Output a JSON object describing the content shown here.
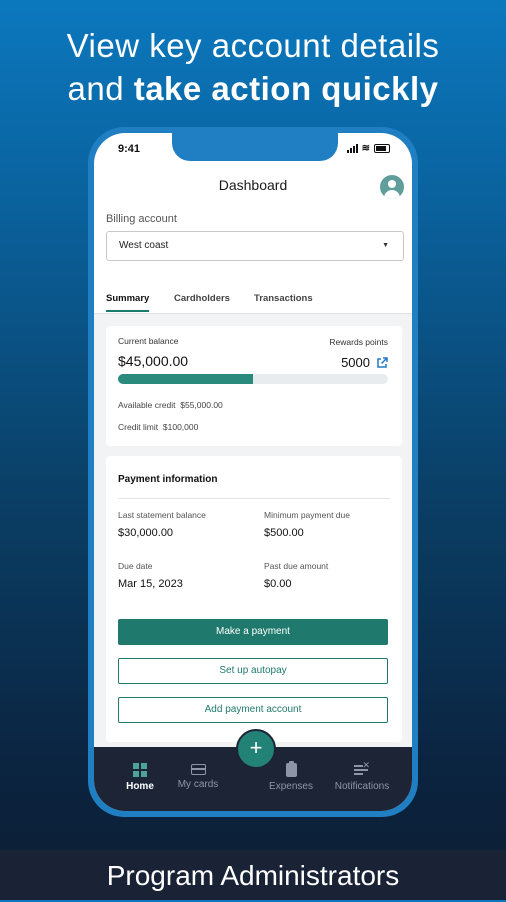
{
  "headline": {
    "line1": "View key account details",
    "line2_regular": "and ",
    "line2_bold": "take action quickly"
  },
  "footer": {
    "text": "Program Administrators"
  },
  "statusbar": {
    "time": "9:41"
  },
  "header": {
    "title": "Dashboard",
    "avatar_icon": "user-avatar-icon"
  },
  "billing": {
    "label": "Billing account",
    "selected": "West coast",
    "caret": "▼"
  },
  "tabs": [
    {
      "label": "Summary",
      "active": true
    },
    {
      "label": "Cardholders",
      "active": false
    },
    {
      "label": "Transactions",
      "active": false
    }
  ],
  "summary": {
    "current_balance_label": "Current balance",
    "current_balance": "$45,000.00",
    "rewards_label": "Rewards points",
    "rewards_value": "5000",
    "progress_fraction": 0.5,
    "available_credit_label": "Available credit",
    "available_credit": "$55,000.00",
    "credit_limit_label": "Credit limit",
    "credit_limit": "$100,000"
  },
  "payment": {
    "title": "Payment information",
    "last_statement_label": "Last statement balance",
    "last_statement": "$30,000.00",
    "minimum_due_label": "Minimum payment due",
    "minimum_due": "$500.00",
    "due_date_label": "Due date",
    "due_date": "Mar 15, 2023",
    "past_due_label": "Past due amount",
    "past_due": "$0.00",
    "make_payment": "Make a payment",
    "autopay": "Set up autopay",
    "add_account": "Add payment account"
  },
  "nav": {
    "home": "Home",
    "my_cards": "My cards",
    "fab": "+",
    "expenses": "Expenses",
    "notifications": "Notifications"
  },
  "colors": {
    "accent_teal": "#1f7a6d",
    "phone_frame": "#1f7fc2",
    "nav_bg": "#1c2436",
    "link_blue": "#1f78c8"
  }
}
